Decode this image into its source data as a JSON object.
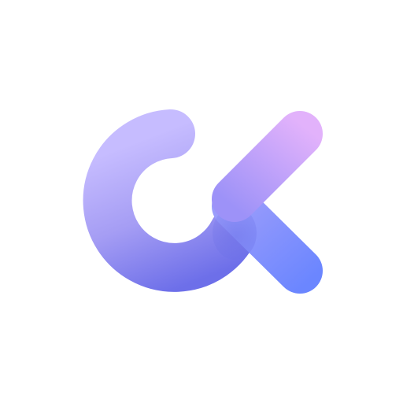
{
  "background_color": "#ffffff",
  "logo": {
    "icon": "ck-monogram-logo-icon",
    "c_stroke": {
      "gradient_start": "#c6bcff",
      "gradient_mid": "#a59df4",
      "gradient_end": "#6d6fe9"
    },
    "k_upper_arm": {
      "gradient_start": "#e2b2fb",
      "gradient_end": "#9d92f8"
    },
    "k_lower_arm": {
      "gradient_start": "#9a9cfb",
      "gradient_end": "#6b86ff"
    },
    "k_junction_shadow": "#6a6fe6"
  }
}
